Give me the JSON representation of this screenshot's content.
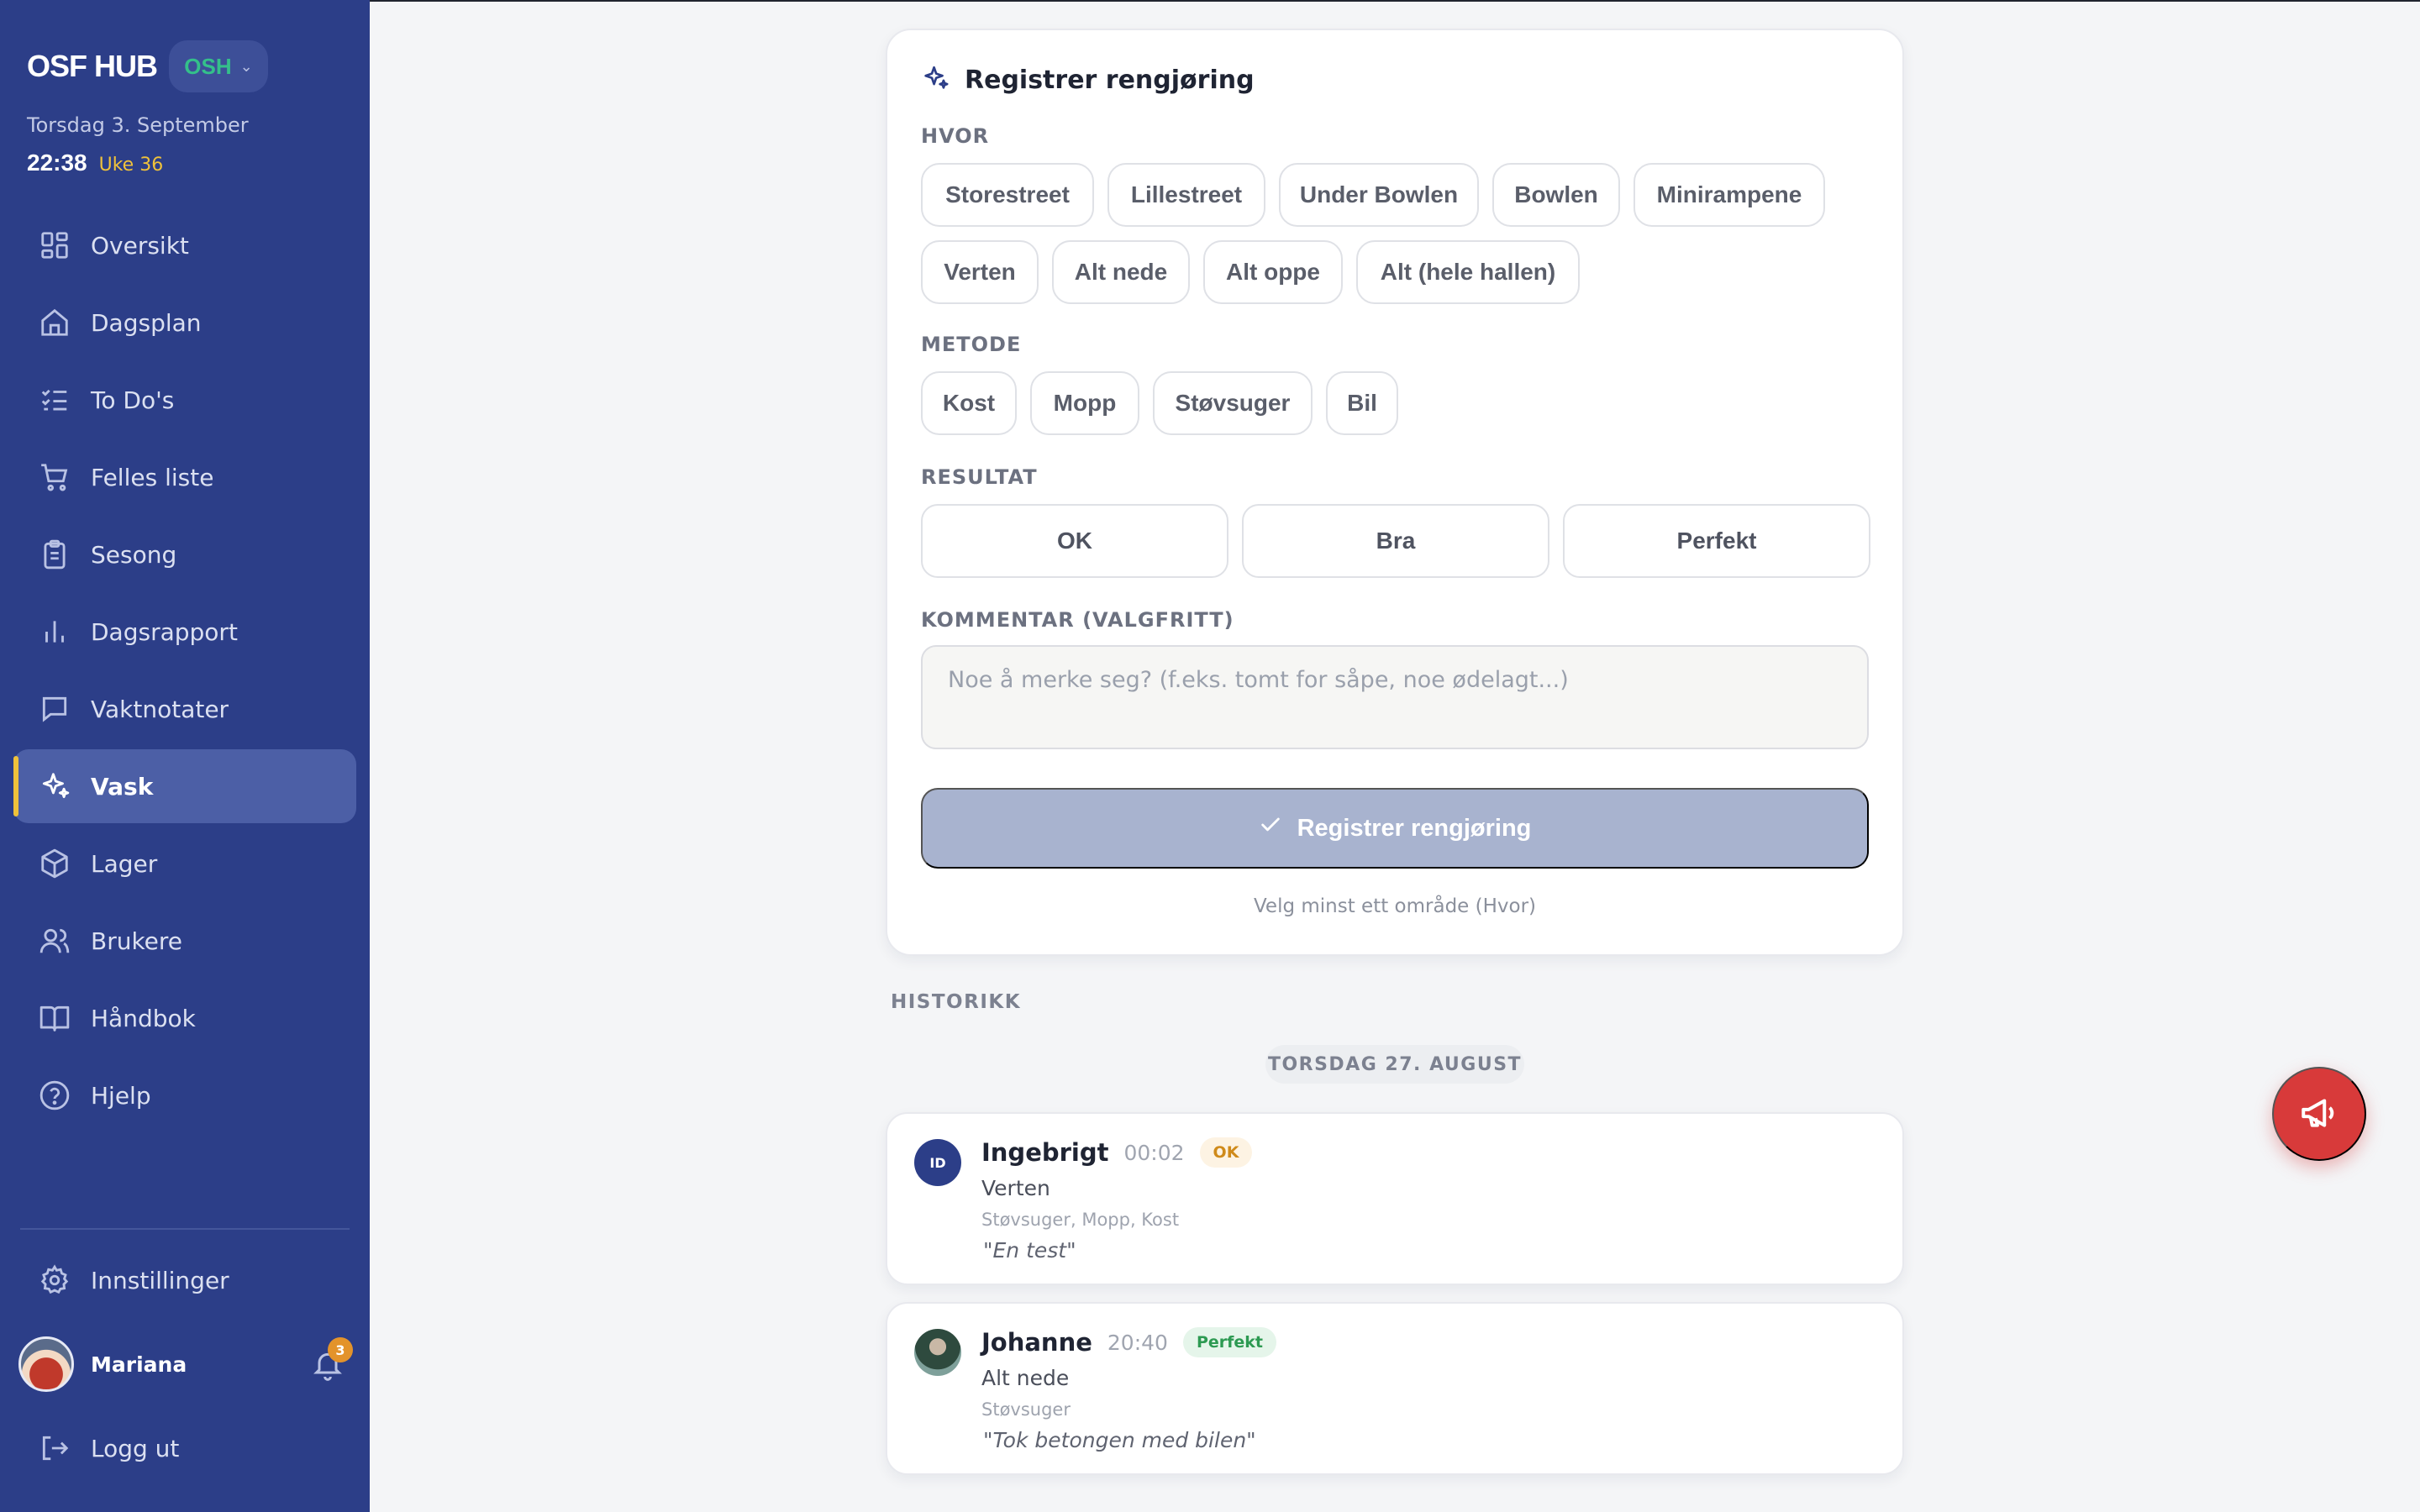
{
  "app": {
    "title": "OSF HUB",
    "org_code": "OSH"
  },
  "header": {
    "date": "Torsdag 3. September",
    "time": "22:38",
    "week": "Uke 36"
  },
  "sidebar": {
    "items": [
      {
        "label": "Oversikt",
        "icon": "grid-icon"
      },
      {
        "label": "Dagsplan",
        "icon": "home-icon"
      },
      {
        "label": "To Do's",
        "icon": "checklist-icon"
      },
      {
        "label": "Felles liste",
        "icon": "cart-icon"
      },
      {
        "label": "Sesong",
        "icon": "clipboard-icon"
      },
      {
        "label": "Dagsrapport",
        "icon": "bar-chart-icon"
      },
      {
        "label": "Vaktnotater",
        "icon": "message-icon"
      },
      {
        "label": "Vask",
        "icon": "sparkles-icon",
        "active": true
      },
      {
        "label": "Lager",
        "icon": "package-icon"
      },
      {
        "label": "Brukere",
        "icon": "users-icon"
      },
      {
        "label": "Håndbok",
        "icon": "book-icon"
      },
      {
        "label": "Hjelp",
        "icon": "help-icon"
      }
    ],
    "settings_label": "Innstillinger",
    "user_name": "Mariana",
    "notification_count": "3",
    "logout_label": "Logg ut"
  },
  "form": {
    "title": "Registrer rengjøring",
    "where_label": "HVOR",
    "where_options": [
      "Storestreet",
      "Lillestreet",
      "Under Bowlen",
      "Bowlen",
      "Minirampene",
      "Verten",
      "Alt nede",
      "Alt oppe",
      "Alt (hele hallen)"
    ],
    "method_label": "METODE",
    "method_options": [
      "Kost",
      "Mopp",
      "Støvsuger",
      "Bil"
    ],
    "result_label": "RESULTAT",
    "result_options": [
      "OK",
      "Bra",
      "Perfekt"
    ],
    "comment_label": "KOMMENTAR (VALGFRITT)",
    "comment_placeholder": "Noe å merke seg? (f.eks. tomt for såpe, noe ødelagt...)",
    "submit_label": "Registrer rengjøring",
    "hint": "Velg minst ett område (Hvor)"
  },
  "history": {
    "label": "HISTORIKK",
    "date_header": "TORSDAG 27. AUGUST",
    "entries": [
      {
        "initials": "ID",
        "name": "Ingebrigt",
        "time": "00:02",
        "result": "OK",
        "where": "Verten",
        "methods": "Støvsuger, Mopp, Kost",
        "comment": "\"En test\""
      },
      {
        "name": "Johanne",
        "time": "20:40",
        "result": "Perfekt",
        "where": "Alt nede",
        "methods": "Støvsuger",
        "comment": "\"Tok betongen med bilen\""
      }
    ]
  },
  "colors": {
    "sidebar": "#2c3e88",
    "accent": "#f0c23a",
    "fab": "#d83a3a",
    "submit_disabled": "#a8b3cf"
  }
}
